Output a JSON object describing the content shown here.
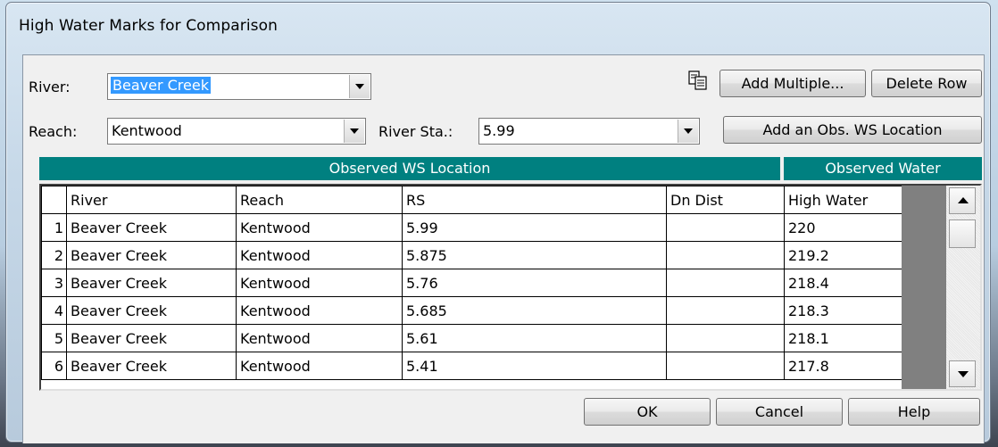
{
  "window": {
    "title": "High Water Marks for Comparison"
  },
  "selectors": {
    "river_label": "River:",
    "river_value": "Beaver Creek",
    "reach_label": "Reach:",
    "reach_value": "Kentwood",
    "river_sta_label": "River Sta.:",
    "river_sta_value": "5.99"
  },
  "toolbar": {
    "copy_icon": "copy-icon",
    "add_multiple_label": "Add Multiple...",
    "delete_row_label": "Delete Row",
    "add_obs_label": "Add an Obs. WS Location"
  },
  "group_headers": {
    "observed_ws_location": "Observed WS Location",
    "observed_water": "Observed Water"
  },
  "table": {
    "columns": [
      "River",
      "Reach",
      "RS",
      "Dn Dist",
      "High Water"
    ],
    "rows": [
      {
        "n": "1",
        "river": "Beaver Creek",
        "reach": "Kentwood",
        "rs": "5.99",
        "dn": "",
        "hw": "220"
      },
      {
        "n": "2",
        "river": "Beaver Creek",
        "reach": "Kentwood",
        "rs": "5.875",
        "dn": "",
        "hw": "219.2"
      },
      {
        "n": "3",
        "river": "Beaver Creek",
        "reach": "Kentwood",
        "rs": "5.76",
        "dn": "",
        "hw": "218.4"
      },
      {
        "n": "4",
        "river": "Beaver Creek",
        "reach": "Kentwood",
        "rs": "5.685",
        "dn": "",
        "hw": "218.3"
      },
      {
        "n": "5",
        "river": "Beaver Creek",
        "reach": "Kentwood",
        "rs": "5.61",
        "dn": "",
        "hw": "218.1"
      },
      {
        "n": "6",
        "river": "Beaver Creek",
        "reach": "Kentwood",
        "rs": "5.41",
        "dn": "",
        "hw": "217.8"
      }
    ]
  },
  "footer": {
    "ok_label": "OK",
    "cancel_label": "Cancel",
    "help_label": "Help"
  },
  "colors": {
    "header_teal": "#008080",
    "selection_blue": "#3399ff"
  }
}
